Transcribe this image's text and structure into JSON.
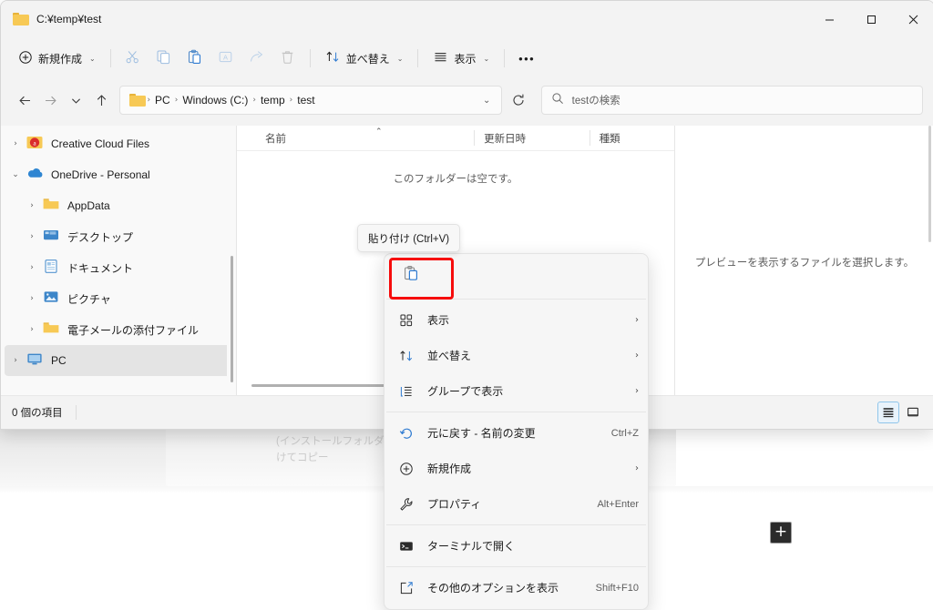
{
  "window": {
    "title": "C:¥temp¥test",
    "folder_icon": "folder-icon",
    "controls": {
      "minimize": "minimize-icon",
      "maximize": "maximize-icon",
      "close": "close-icon"
    }
  },
  "commandbar": {
    "new_label": "新規作成",
    "new_icon": "plus-circle-icon",
    "cut_icon": "scissors-icon",
    "copy_icon": "copy-icon",
    "paste_icon": "paste-icon",
    "rename_icon": "rename-icon",
    "share_icon": "share-icon",
    "delete_icon": "trash-icon",
    "sort_label": "並べ替え",
    "sort_icon": "sort-icon",
    "view_label": "表示",
    "view_icon": "list-icon",
    "more_label": "...",
    "more_icon": "ellipsis-icon"
  },
  "addressbar": {
    "back_icon": "arrow-left-icon",
    "forward_icon": "arrow-right-icon",
    "recent_icon": "chevron-down-icon",
    "up_icon": "arrow-up-icon",
    "folder_icon": "folder-icon",
    "crumbs": [
      "PC",
      "Windows (C:)",
      "temp",
      "test"
    ],
    "separator": "›",
    "dropdown_icon": "chevron-down-icon",
    "refresh_icon": "refresh-icon"
  },
  "search": {
    "icon": "search-icon",
    "placeholder": "testの検索"
  },
  "navpane": {
    "items": [
      {
        "label": "Creative Cloud Files",
        "icon": "creative-cloud-icon",
        "twisty": "›",
        "level": 1,
        "selected": false
      },
      {
        "label": "OneDrive - Personal",
        "icon": "onedrive-icon",
        "twisty": "⌄",
        "level": 1,
        "selected": false
      },
      {
        "label": "AppData",
        "icon": "folder-icon",
        "twisty": "›",
        "level": 2,
        "selected": false
      },
      {
        "label": "デスクトップ",
        "icon": "desktop-icon",
        "twisty": "›",
        "level": 2,
        "selected": false
      },
      {
        "label": "ドキュメント",
        "icon": "documents-icon",
        "twisty": "›",
        "level": 2,
        "selected": false
      },
      {
        "label": "ピクチャ",
        "icon": "pictures-icon",
        "twisty": "›",
        "level": 2,
        "selected": false
      },
      {
        "label": "電子メールの添付ファイル",
        "icon": "folder-icon",
        "twisty": "›",
        "level": 2,
        "selected": false
      },
      {
        "label": "PC",
        "icon": "pc-icon",
        "twisty": "›",
        "level": 1,
        "selected": true
      }
    ]
  },
  "filelist": {
    "columns": [
      "名前",
      "更新日時",
      "種類"
    ],
    "sort_caret": "⌃",
    "empty_message": "このフォルダーは空です。"
  },
  "preview": {
    "message": "プレビューを表示するファイルを選択します。"
  },
  "statusbar": {
    "item_count": "0 個の項目",
    "details_view_icon": "details-view-icon",
    "preview-pane_icon": "preview-pane-icon"
  },
  "tooltip": {
    "text": "貼り付け (Ctrl+V)"
  },
  "contextmenu": {
    "toolbar": [
      {
        "icon": "paste-icon",
        "name": "paste"
      }
    ],
    "items": [
      {
        "label": "表示",
        "icon": "grid-view-icon",
        "accel": "",
        "arrow": "›"
      },
      {
        "label": "並べ替え",
        "icon": "sort-icon",
        "accel": "",
        "arrow": "›"
      },
      {
        "label": "グループで表示",
        "icon": "group-icon",
        "accel": "",
        "arrow": "›"
      },
      {
        "label": "元に戻す - 名前の変更",
        "icon": "undo-icon",
        "accel": "Ctrl+Z",
        "arrow": ""
      },
      {
        "label": "新規作成",
        "icon": "plus-circle-icon",
        "accel": "",
        "arrow": "›"
      },
      {
        "label": "プロパティ",
        "icon": "wrench-icon",
        "accel": "Alt+Enter",
        "arrow": ""
      },
      {
        "label": "ターミナルで開く",
        "icon": "terminal-icon",
        "accel": "",
        "arrow": ""
      },
      {
        "label": "その他のオプションを表示",
        "icon": "more-options-icon",
        "accel": "Shift+F10",
        "arrow": ""
      }
    ]
  },
  "background": {
    "text_line1": "(インストールフォルダ",
    "text_line2": "けてコピー",
    "plus_button": "+"
  },
  "colors": {
    "accent": "#0f6cbd",
    "highlight_red": "#f60c0c",
    "folder_yellow": "#f7c955",
    "window_chrome": "#f3f3f3"
  }
}
